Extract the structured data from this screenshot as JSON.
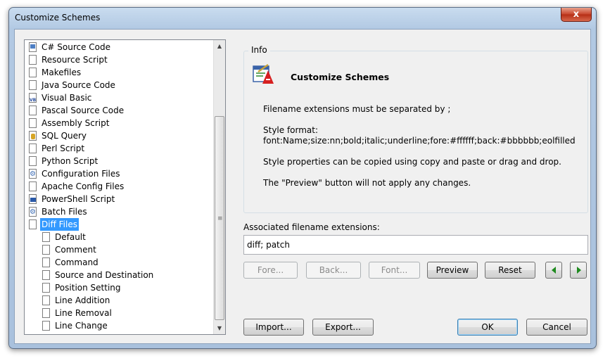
{
  "window": {
    "title": "Customize Schemes",
    "close_glyph": "x"
  },
  "tree": {
    "items": [
      {
        "label": "C# Source Code",
        "icon": "csharp-file-icon"
      },
      {
        "label": "Resource Script",
        "icon": "document-icon"
      },
      {
        "label": "Makefiles",
        "icon": "document-icon"
      },
      {
        "label": "Java Source Code",
        "icon": "document-icon"
      },
      {
        "label": "Visual Basic",
        "icon": "vb-file-icon"
      },
      {
        "label": "Pascal Source Code",
        "icon": "document-icon"
      },
      {
        "label": "Assembly Script",
        "icon": "document-icon"
      },
      {
        "label": "SQL Query",
        "icon": "sql-file-icon"
      },
      {
        "label": "Perl Script",
        "icon": "document-icon"
      },
      {
        "label": "Python Script",
        "icon": "document-icon"
      },
      {
        "label": "Configuration Files",
        "icon": "config-file-icon"
      },
      {
        "label": "Apache Config Files",
        "icon": "document-icon"
      },
      {
        "label": "PowerShell Script",
        "icon": "powershell-file-icon"
      },
      {
        "label": "Batch Files",
        "icon": "batch-file-icon"
      },
      {
        "label": "Diff Files",
        "icon": "document-icon",
        "selected": true
      }
    ],
    "children": [
      "Default",
      "Comment",
      "Command",
      "Source and Destination",
      "Position Setting",
      "Line Addition",
      "Line Removal",
      "Line Change"
    ],
    "scroll_up": "▲",
    "scroll_down": "▼",
    "grip": "≡"
  },
  "info": {
    "legend": "Info",
    "title": "Customize Schemes",
    "line1": "Filename extensions must be separated by ;",
    "line2": "Style format:",
    "line3": "font:Name;size:nn;bold;italic;underline;fore:#ffffff;back:#bbbbbb;eolfilled",
    "line4": "Style properties can be copied using copy and paste or drag and drop.",
    "line5": "The \"Preview\" button will not apply any changes."
  },
  "extensions": {
    "label": "Associated filename extensions:",
    "value": "diff; patch"
  },
  "buttons": {
    "fore": "Fore...",
    "back": "Back...",
    "font": "Font...",
    "preview": "Preview",
    "reset": "Reset",
    "import": "Import...",
    "export": "Export...",
    "ok": "OK",
    "cancel": "Cancel"
  },
  "colors": {
    "selection": "#3399ff",
    "arrow_green": "#1e8a1e"
  }
}
